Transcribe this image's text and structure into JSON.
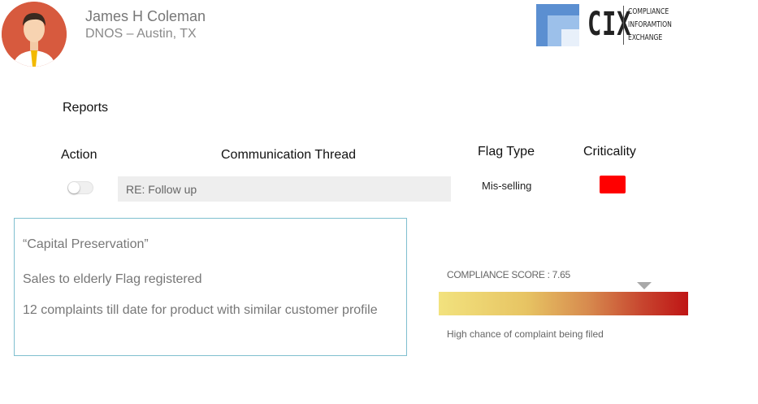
{
  "user": {
    "name": "James H Coleman",
    "location": "DNOS – Austin,  TX",
    "avatar_icon": "person-avatar-icon"
  },
  "logo": {
    "mark": "CIX",
    "lines": [
      "COMPLIANCE",
      "INFORAMTION",
      "EXCHANGE"
    ]
  },
  "reports": {
    "title": "Reports"
  },
  "table": {
    "headers": {
      "action": "Action",
      "thread": "Communication Thread",
      "flag_type": "Flag Type",
      "criticality": "Criticality"
    },
    "rows": [
      {
        "toggle_on": false,
        "thread": "RE: Follow up",
        "flag_type": "Mis-selling",
        "criticality_color": "#ff0000"
      }
    ]
  },
  "details": {
    "quote": "“Capital Preservation”",
    "line1": "Sales to elderly Flag registered",
    "line2": "12 complaints till date for product with similar customer profile"
  },
  "compliance": {
    "label": "COMPLIANCE SCORE  : 7.65",
    "note": "High chance of complaint being filed"
  }
}
